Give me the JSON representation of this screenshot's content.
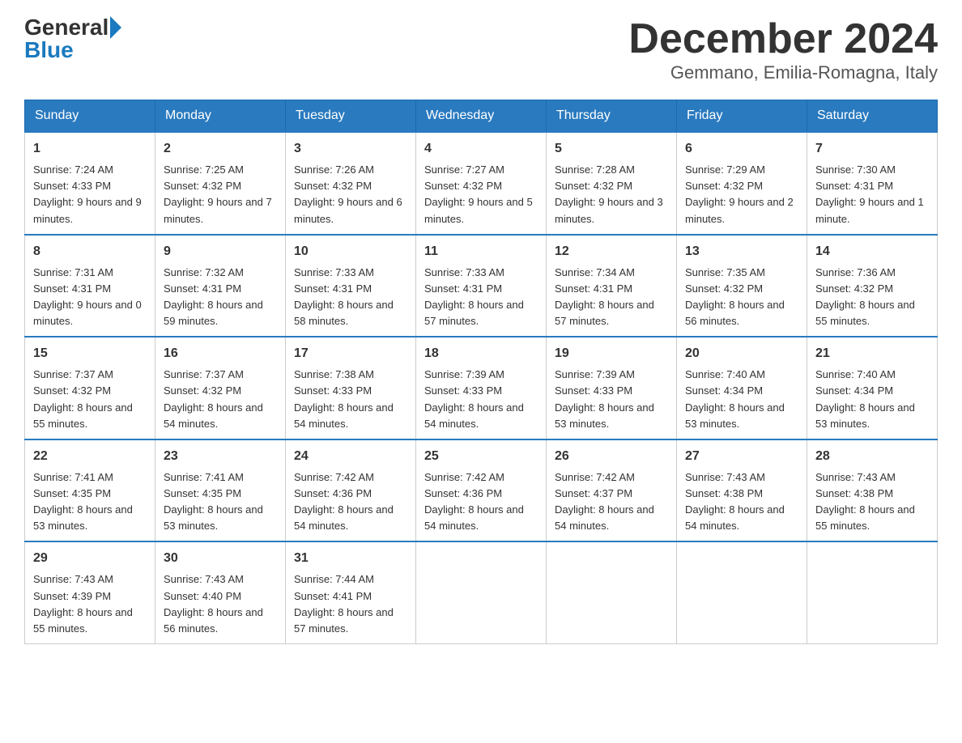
{
  "header": {
    "logo_general": "General",
    "logo_blue": "Blue",
    "title": "December 2024",
    "subtitle": "Gemmano, Emilia-Romagna, Italy"
  },
  "days_of_week": [
    "Sunday",
    "Monday",
    "Tuesday",
    "Wednesday",
    "Thursday",
    "Friday",
    "Saturday"
  ],
  "weeks": [
    [
      {
        "day": "1",
        "sunrise": "7:24 AM",
        "sunset": "4:33 PM",
        "daylight": "9 hours and 9 minutes."
      },
      {
        "day": "2",
        "sunrise": "7:25 AM",
        "sunset": "4:32 PM",
        "daylight": "9 hours and 7 minutes."
      },
      {
        "day": "3",
        "sunrise": "7:26 AM",
        "sunset": "4:32 PM",
        "daylight": "9 hours and 6 minutes."
      },
      {
        "day": "4",
        "sunrise": "7:27 AM",
        "sunset": "4:32 PM",
        "daylight": "9 hours and 5 minutes."
      },
      {
        "day": "5",
        "sunrise": "7:28 AM",
        "sunset": "4:32 PM",
        "daylight": "9 hours and 3 minutes."
      },
      {
        "day": "6",
        "sunrise": "7:29 AM",
        "sunset": "4:32 PM",
        "daylight": "9 hours and 2 minutes."
      },
      {
        "day": "7",
        "sunrise": "7:30 AM",
        "sunset": "4:31 PM",
        "daylight": "9 hours and 1 minute."
      }
    ],
    [
      {
        "day": "8",
        "sunrise": "7:31 AM",
        "sunset": "4:31 PM",
        "daylight": "9 hours and 0 minutes."
      },
      {
        "day": "9",
        "sunrise": "7:32 AM",
        "sunset": "4:31 PM",
        "daylight": "8 hours and 59 minutes."
      },
      {
        "day": "10",
        "sunrise": "7:33 AM",
        "sunset": "4:31 PM",
        "daylight": "8 hours and 58 minutes."
      },
      {
        "day": "11",
        "sunrise": "7:33 AM",
        "sunset": "4:31 PM",
        "daylight": "8 hours and 57 minutes."
      },
      {
        "day": "12",
        "sunrise": "7:34 AM",
        "sunset": "4:31 PM",
        "daylight": "8 hours and 57 minutes."
      },
      {
        "day": "13",
        "sunrise": "7:35 AM",
        "sunset": "4:32 PM",
        "daylight": "8 hours and 56 minutes."
      },
      {
        "day": "14",
        "sunrise": "7:36 AM",
        "sunset": "4:32 PM",
        "daylight": "8 hours and 55 minutes."
      }
    ],
    [
      {
        "day": "15",
        "sunrise": "7:37 AM",
        "sunset": "4:32 PM",
        "daylight": "8 hours and 55 minutes."
      },
      {
        "day": "16",
        "sunrise": "7:37 AM",
        "sunset": "4:32 PM",
        "daylight": "8 hours and 54 minutes."
      },
      {
        "day": "17",
        "sunrise": "7:38 AM",
        "sunset": "4:33 PM",
        "daylight": "8 hours and 54 minutes."
      },
      {
        "day": "18",
        "sunrise": "7:39 AM",
        "sunset": "4:33 PM",
        "daylight": "8 hours and 54 minutes."
      },
      {
        "day": "19",
        "sunrise": "7:39 AM",
        "sunset": "4:33 PM",
        "daylight": "8 hours and 53 minutes."
      },
      {
        "day": "20",
        "sunrise": "7:40 AM",
        "sunset": "4:34 PM",
        "daylight": "8 hours and 53 minutes."
      },
      {
        "day": "21",
        "sunrise": "7:40 AM",
        "sunset": "4:34 PM",
        "daylight": "8 hours and 53 minutes."
      }
    ],
    [
      {
        "day": "22",
        "sunrise": "7:41 AM",
        "sunset": "4:35 PM",
        "daylight": "8 hours and 53 minutes."
      },
      {
        "day": "23",
        "sunrise": "7:41 AM",
        "sunset": "4:35 PM",
        "daylight": "8 hours and 53 minutes."
      },
      {
        "day": "24",
        "sunrise": "7:42 AM",
        "sunset": "4:36 PM",
        "daylight": "8 hours and 54 minutes."
      },
      {
        "day": "25",
        "sunrise": "7:42 AM",
        "sunset": "4:36 PM",
        "daylight": "8 hours and 54 minutes."
      },
      {
        "day": "26",
        "sunrise": "7:42 AM",
        "sunset": "4:37 PM",
        "daylight": "8 hours and 54 minutes."
      },
      {
        "day": "27",
        "sunrise": "7:43 AM",
        "sunset": "4:38 PM",
        "daylight": "8 hours and 54 minutes."
      },
      {
        "day": "28",
        "sunrise": "7:43 AM",
        "sunset": "4:38 PM",
        "daylight": "8 hours and 55 minutes."
      }
    ],
    [
      {
        "day": "29",
        "sunrise": "7:43 AM",
        "sunset": "4:39 PM",
        "daylight": "8 hours and 55 minutes."
      },
      {
        "day": "30",
        "sunrise": "7:43 AM",
        "sunset": "4:40 PM",
        "daylight": "8 hours and 56 minutes."
      },
      {
        "day": "31",
        "sunrise": "7:44 AM",
        "sunset": "4:41 PM",
        "daylight": "8 hours and 57 minutes."
      },
      null,
      null,
      null,
      null
    ]
  ]
}
